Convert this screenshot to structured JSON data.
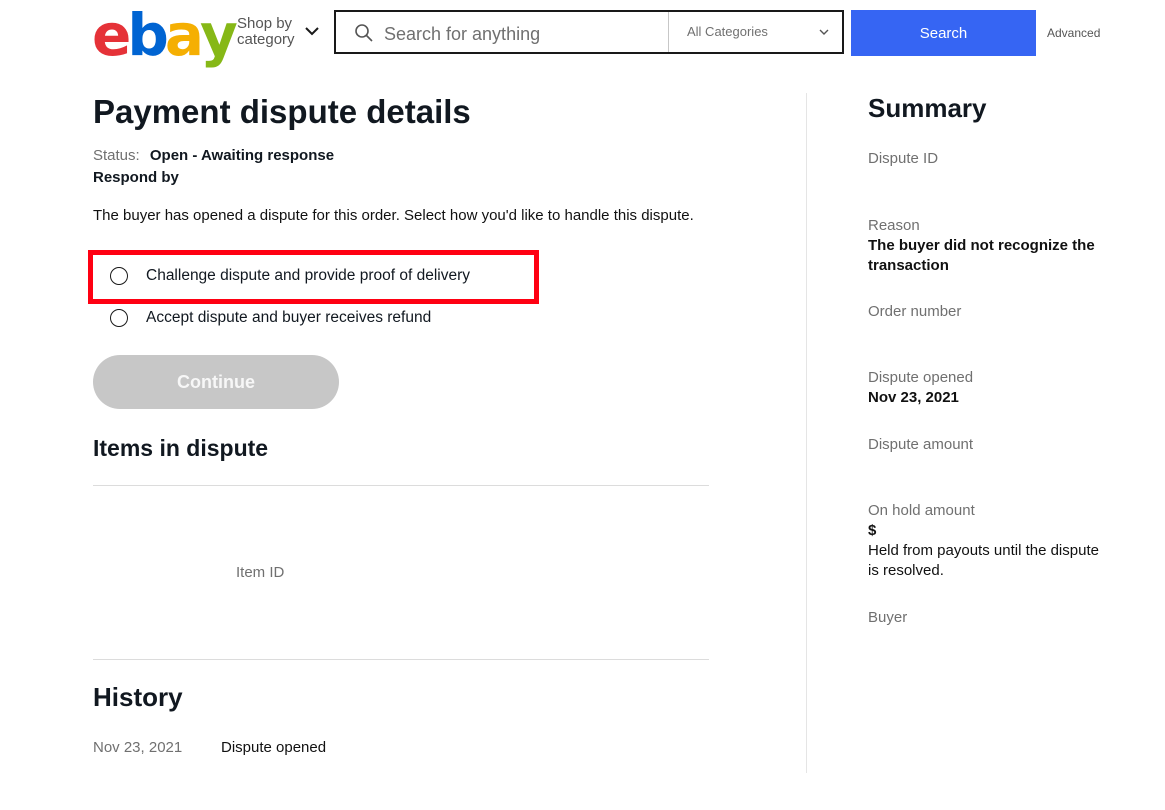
{
  "header": {
    "logo_letters": [
      {
        "char": "e",
        "color": "#e53238"
      },
      {
        "char": "b",
        "color": "#0064d2"
      },
      {
        "char": "a",
        "color": "#f5af02"
      },
      {
        "char": "y",
        "color": "#86b817"
      }
    ],
    "shop_by_line1": "Shop by",
    "shop_by_line2": "category",
    "search_placeholder": "Search for anything",
    "category_label": "All Categories",
    "search_button": "Search",
    "advanced_link": "Advanced",
    "accent_color": "#3665f3"
  },
  "main": {
    "title": "Payment dispute details",
    "status_label": "Status:",
    "status_value": "Open - Awaiting response",
    "respond_by": "Respond by",
    "intro": "The buyer has opened a dispute for this order. Select how you'd like to handle this dispute.",
    "options": [
      {
        "label": "Challenge dispute and provide proof of delivery",
        "selected": false
      },
      {
        "label": "Accept dispute and buyer receives refund",
        "selected": false
      }
    ],
    "continue_button": "Continue",
    "items_title": "Items in dispute",
    "item_id_label": "Item ID",
    "history_title": "History",
    "history": [
      {
        "date": "Nov 23, 2021",
        "event": "Dispute opened"
      }
    ]
  },
  "summary": {
    "title": "Summary",
    "dispute_id_label": "Dispute ID",
    "reason_label": "Reason",
    "reason_value": "The buyer did not recognize the transaction",
    "order_number_label": "Order number",
    "dispute_opened_label": "Dispute opened",
    "dispute_opened_value": "Nov 23, 2021",
    "dispute_amount_label": "Dispute amount",
    "on_hold_label": "On hold amount",
    "on_hold_value": "$",
    "on_hold_note": "Held from payouts until the dispute is resolved.",
    "buyer_label": "Buyer"
  }
}
